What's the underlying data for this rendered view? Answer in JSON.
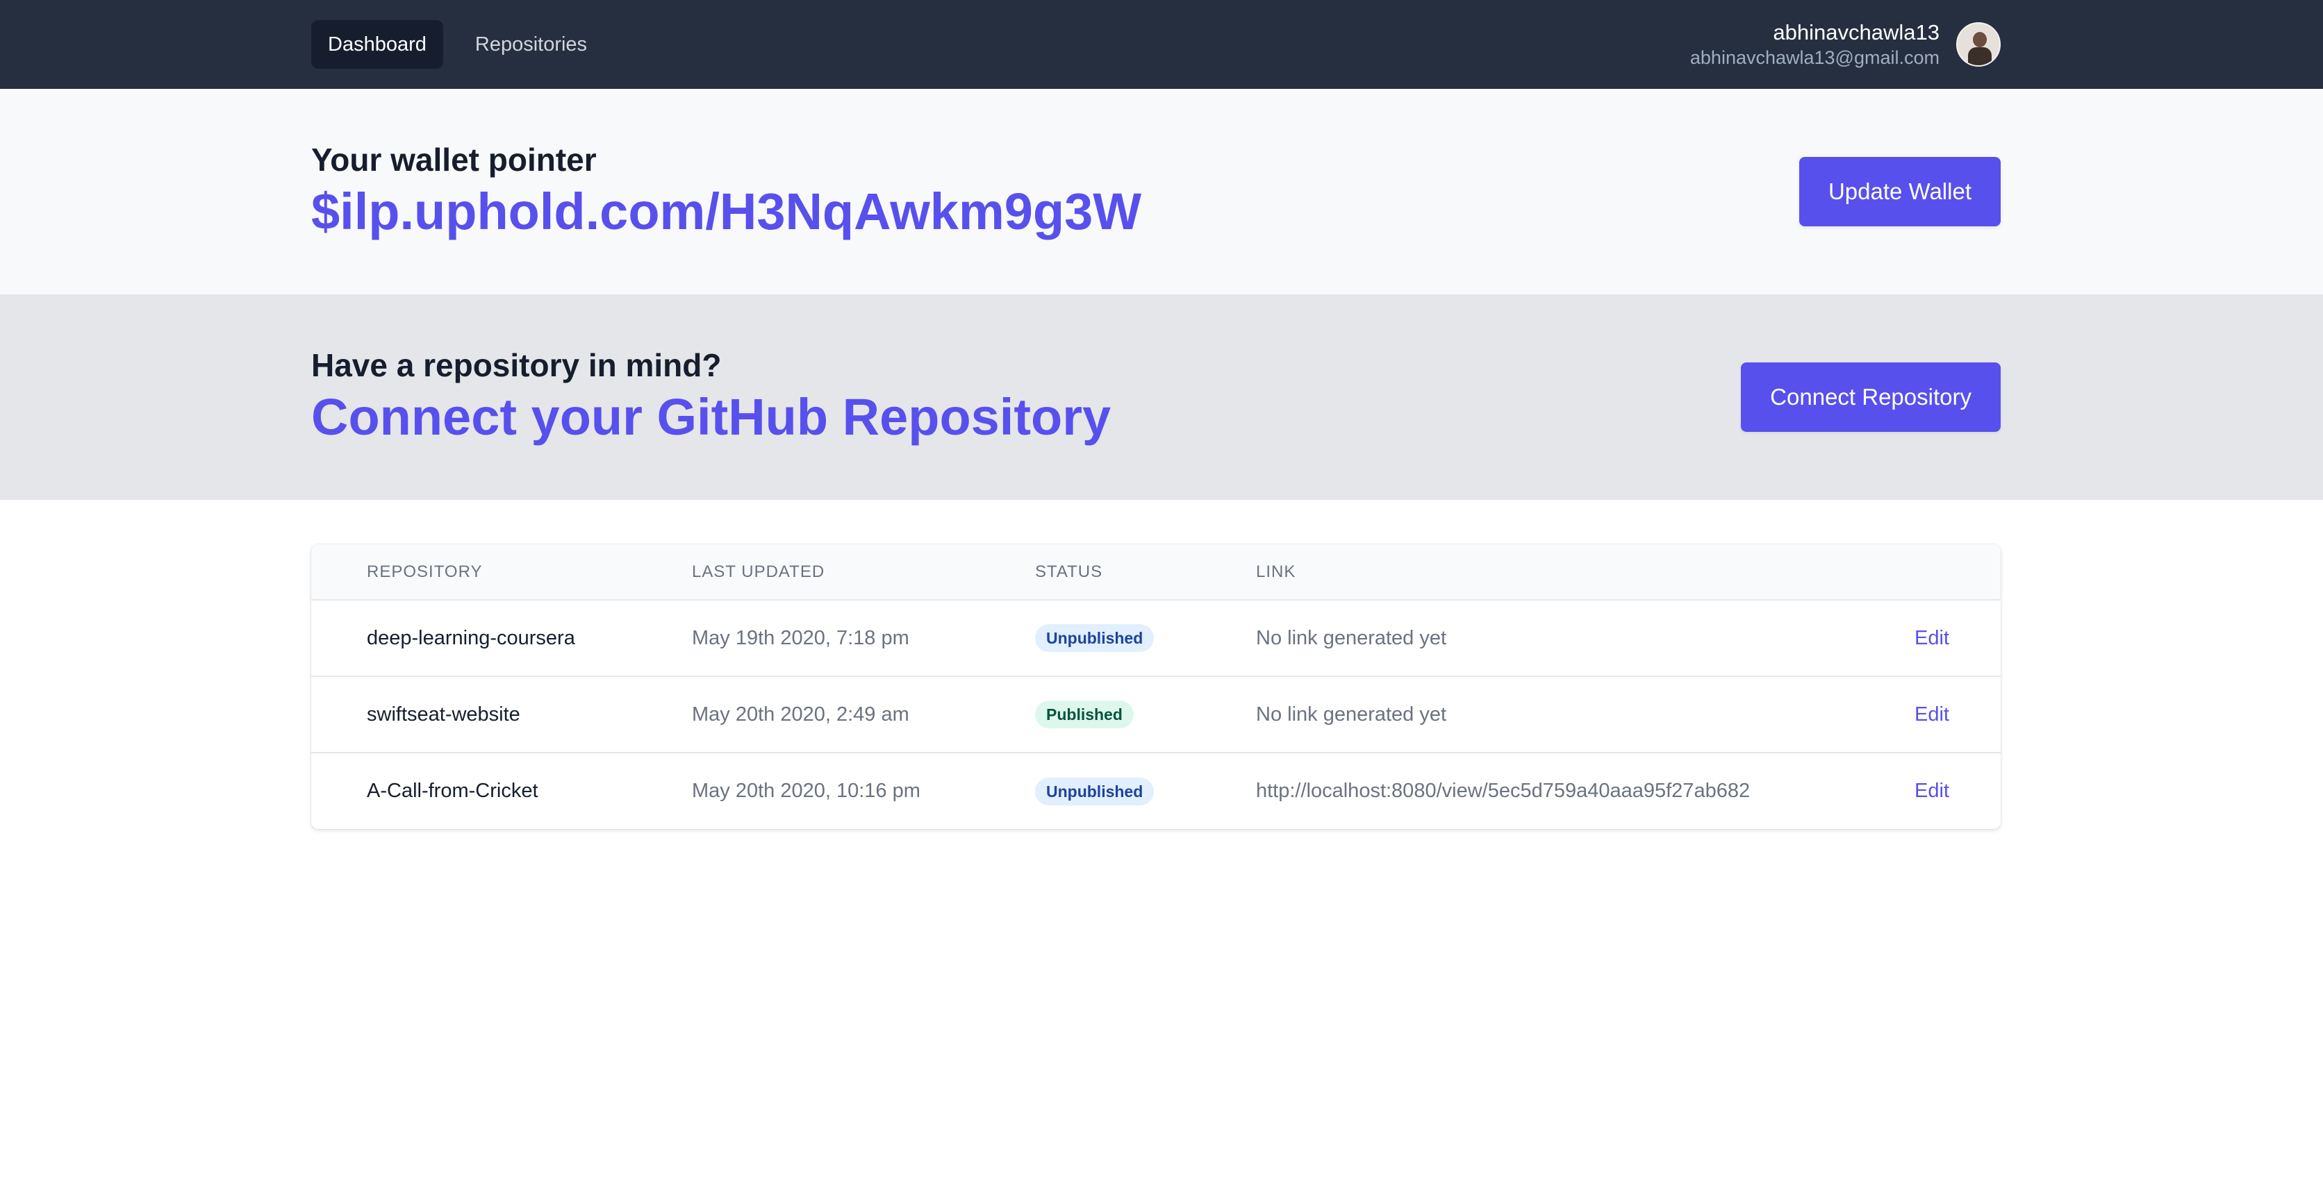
{
  "nav": {
    "links": [
      {
        "label": "Dashboard",
        "active": true
      },
      {
        "label": "Repositories",
        "active": false
      }
    ],
    "user": {
      "name": "abhinavchawla13",
      "email": "abhinavchawla13@gmail.com"
    }
  },
  "wallet": {
    "subtitle": "Your wallet pointer",
    "pointer": "$ilp.uphold.com/H3NqAwkm9g3W",
    "button": "Update Wallet"
  },
  "connect": {
    "subtitle": "Have a repository in mind?",
    "title": "Connect your GitHub Repository",
    "button": "Connect Repository"
  },
  "table": {
    "headers": [
      "REPOSITORY",
      "LAST UPDATED",
      "STATUS",
      "LINK"
    ],
    "rows": [
      {
        "repo": "deep-learning-coursera",
        "updated": "May 19th 2020, 7:18 pm",
        "status": "Unpublished",
        "link": "No link generated yet",
        "action": "Edit"
      },
      {
        "repo": "swiftseat-website",
        "updated": "May 20th 2020, 2:49 am",
        "status": "Published",
        "link": "No link generated yet",
        "action": "Edit"
      },
      {
        "repo": "A-Call-from-Cricket",
        "updated": "May 20th 2020, 10:16 pm",
        "status": "Unpublished",
        "link": "http://localhost:8080/view/5ec5d759a40aaa95f27ab682",
        "action": "Edit"
      }
    ]
  },
  "colors": {
    "nav_bg": "#252f3f",
    "accent": "#5850ec",
    "published_bg": "#def7ec",
    "unpublished_bg": "#e1effe"
  }
}
